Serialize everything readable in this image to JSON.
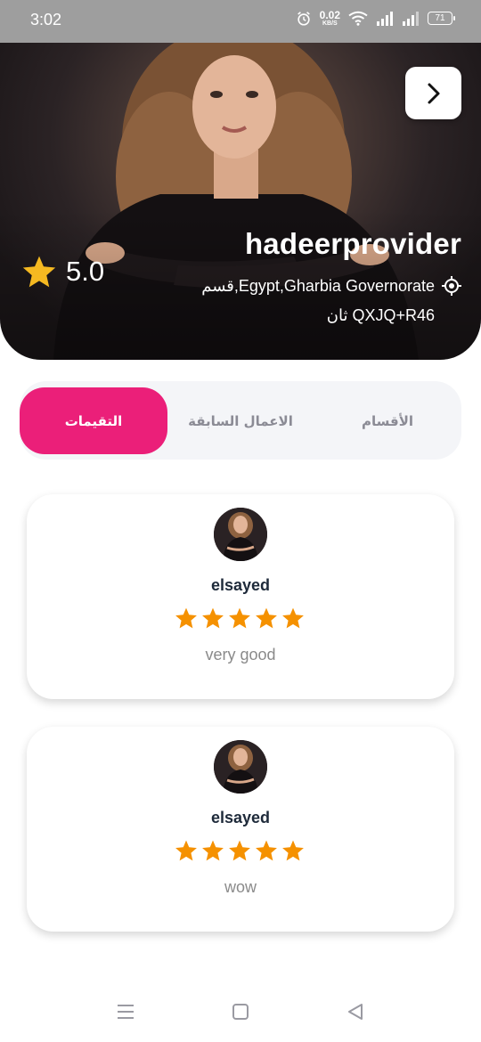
{
  "status_bar": {
    "time": "3:02",
    "net_speed_value": "0.02",
    "net_speed_unit": "KB/S",
    "battery": "71",
    "icons": [
      "alarm-icon",
      "wifi-icon",
      "signal-icon",
      "signal-icon",
      "battery-icon"
    ]
  },
  "profile": {
    "name": "hadeerprovider",
    "location": "قسم,Egypt,Gharbia Governorate",
    "address": "ثان QXJQ+R46",
    "rating": "5.0",
    "rating_icon": "star-icon",
    "location_icon": "location-target-icon",
    "forward_icon": "chevron-right-icon"
  },
  "tabs": [
    {
      "label": "الأقسام",
      "active": false
    },
    {
      "label": "الاعمال السابقة",
      "active": false
    },
    {
      "label": "التقيمات",
      "active": true
    }
  ],
  "colors": {
    "accent": "#eb1f79",
    "star": "#f59100",
    "status_bar_bg": "#9e9e9e"
  },
  "reviews": [
    {
      "name": "elsayed",
      "stars": 5,
      "comment": "very good"
    },
    {
      "name": "elsayed",
      "stars": 5,
      "comment": "wow"
    }
  ],
  "nav": {
    "icons": [
      "menu-icon",
      "home-square-icon",
      "back-triangle-icon"
    ]
  }
}
